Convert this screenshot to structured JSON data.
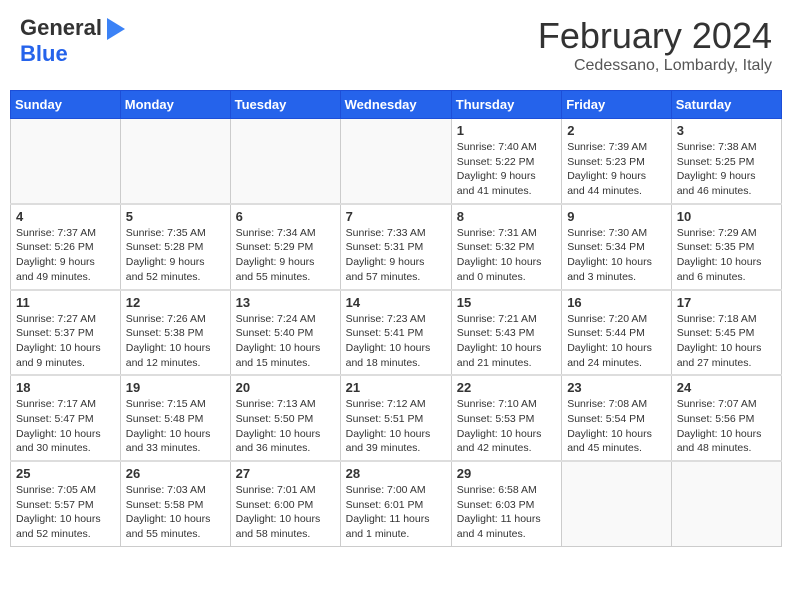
{
  "header": {
    "logo_line1": "General",
    "logo_line2": "Blue",
    "title": "February 2024",
    "subtitle": "Cedessano, Lombardy, Italy"
  },
  "days_of_week": [
    "Sunday",
    "Monday",
    "Tuesday",
    "Wednesday",
    "Thursday",
    "Friday",
    "Saturday"
  ],
  "weeks": [
    [
      {
        "day": "",
        "info": ""
      },
      {
        "day": "",
        "info": ""
      },
      {
        "day": "",
        "info": ""
      },
      {
        "day": "",
        "info": ""
      },
      {
        "day": "1",
        "info": "Sunrise: 7:40 AM\nSunset: 5:22 PM\nDaylight: 9 hours\nand 41 minutes."
      },
      {
        "day": "2",
        "info": "Sunrise: 7:39 AM\nSunset: 5:23 PM\nDaylight: 9 hours\nand 44 minutes."
      },
      {
        "day": "3",
        "info": "Sunrise: 7:38 AM\nSunset: 5:25 PM\nDaylight: 9 hours\nand 46 minutes."
      }
    ],
    [
      {
        "day": "4",
        "info": "Sunrise: 7:37 AM\nSunset: 5:26 PM\nDaylight: 9 hours\nand 49 minutes."
      },
      {
        "day": "5",
        "info": "Sunrise: 7:35 AM\nSunset: 5:28 PM\nDaylight: 9 hours\nand 52 minutes."
      },
      {
        "day": "6",
        "info": "Sunrise: 7:34 AM\nSunset: 5:29 PM\nDaylight: 9 hours\nand 55 minutes."
      },
      {
        "day": "7",
        "info": "Sunrise: 7:33 AM\nSunset: 5:31 PM\nDaylight: 9 hours\nand 57 minutes."
      },
      {
        "day": "8",
        "info": "Sunrise: 7:31 AM\nSunset: 5:32 PM\nDaylight: 10 hours\nand 0 minutes."
      },
      {
        "day": "9",
        "info": "Sunrise: 7:30 AM\nSunset: 5:34 PM\nDaylight: 10 hours\nand 3 minutes."
      },
      {
        "day": "10",
        "info": "Sunrise: 7:29 AM\nSunset: 5:35 PM\nDaylight: 10 hours\nand 6 minutes."
      }
    ],
    [
      {
        "day": "11",
        "info": "Sunrise: 7:27 AM\nSunset: 5:37 PM\nDaylight: 10 hours\nand 9 minutes."
      },
      {
        "day": "12",
        "info": "Sunrise: 7:26 AM\nSunset: 5:38 PM\nDaylight: 10 hours\nand 12 minutes."
      },
      {
        "day": "13",
        "info": "Sunrise: 7:24 AM\nSunset: 5:40 PM\nDaylight: 10 hours\nand 15 minutes."
      },
      {
        "day": "14",
        "info": "Sunrise: 7:23 AM\nSunset: 5:41 PM\nDaylight: 10 hours\nand 18 minutes."
      },
      {
        "day": "15",
        "info": "Sunrise: 7:21 AM\nSunset: 5:43 PM\nDaylight: 10 hours\nand 21 minutes."
      },
      {
        "day": "16",
        "info": "Sunrise: 7:20 AM\nSunset: 5:44 PM\nDaylight: 10 hours\nand 24 minutes."
      },
      {
        "day": "17",
        "info": "Sunrise: 7:18 AM\nSunset: 5:45 PM\nDaylight: 10 hours\nand 27 minutes."
      }
    ],
    [
      {
        "day": "18",
        "info": "Sunrise: 7:17 AM\nSunset: 5:47 PM\nDaylight: 10 hours\nand 30 minutes."
      },
      {
        "day": "19",
        "info": "Sunrise: 7:15 AM\nSunset: 5:48 PM\nDaylight: 10 hours\nand 33 minutes."
      },
      {
        "day": "20",
        "info": "Sunrise: 7:13 AM\nSunset: 5:50 PM\nDaylight: 10 hours\nand 36 minutes."
      },
      {
        "day": "21",
        "info": "Sunrise: 7:12 AM\nSunset: 5:51 PM\nDaylight: 10 hours\nand 39 minutes."
      },
      {
        "day": "22",
        "info": "Sunrise: 7:10 AM\nSunset: 5:53 PM\nDaylight: 10 hours\nand 42 minutes."
      },
      {
        "day": "23",
        "info": "Sunrise: 7:08 AM\nSunset: 5:54 PM\nDaylight: 10 hours\nand 45 minutes."
      },
      {
        "day": "24",
        "info": "Sunrise: 7:07 AM\nSunset: 5:56 PM\nDaylight: 10 hours\nand 48 minutes."
      }
    ],
    [
      {
        "day": "25",
        "info": "Sunrise: 7:05 AM\nSunset: 5:57 PM\nDaylight: 10 hours\nand 52 minutes."
      },
      {
        "day": "26",
        "info": "Sunrise: 7:03 AM\nSunset: 5:58 PM\nDaylight: 10 hours\nand 55 minutes."
      },
      {
        "day": "27",
        "info": "Sunrise: 7:01 AM\nSunset: 6:00 PM\nDaylight: 10 hours\nand 58 minutes."
      },
      {
        "day": "28",
        "info": "Sunrise: 7:00 AM\nSunset: 6:01 PM\nDaylight: 11 hours\nand 1 minute."
      },
      {
        "day": "29",
        "info": "Sunrise: 6:58 AM\nSunset: 6:03 PM\nDaylight: 11 hours\nand 4 minutes."
      },
      {
        "day": "",
        "info": ""
      },
      {
        "day": "",
        "info": ""
      }
    ]
  ]
}
